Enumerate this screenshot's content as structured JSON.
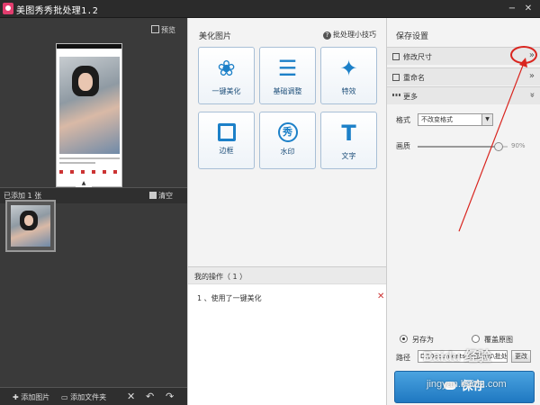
{
  "window": {
    "title": "美图秀秀批处理1.2",
    "minimize_label": "−",
    "close_label": "✕"
  },
  "left_panel": {
    "preview_label": "预览",
    "added_count": "已添加 1 张",
    "clear_label": "清空",
    "collapse_label": "▲",
    "add_image_label": "添加图片",
    "add_folder_label": "添加文件夹",
    "delete_icon": "✕",
    "undo_icon": "↶",
    "redo_icon": "↷"
  },
  "beautify": {
    "title": "美化图片",
    "tips_label": "批处理小技巧",
    "tools": [
      {
        "label": "一键美化",
        "icon": "tulip-icon",
        "glyph": "❀"
      },
      {
        "label": "基础调整",
        "icon": "sliders-icon",
        "glyph": "☰"
      },
      {
        "label": "特效",
        "icon": "magic-wand-icon",
        "glyph": "✦"
      },
      {
        "label": "边框",
        "icon": "frame-icon",
        "glyph": ""
      },
      {
        "label": "水印",
        "icon": "watermark-icon",
        "glyph": "秀"
      },
      {
        "label": "文字",
        "icon": "text-icon",
        "glyph": "T"
      }
    ]
  },
  "operations": {
    "title": "我的操作（ 1 ）",
    "items": [
      {
        "text": "1 、使用了一键美化",
        "remove": "✕"
      }
    ]
  },
  "save_settings": {
    "title": "保存设置",
    "sections": [
      {
        "label": "修改尺寸",
        "chevron": "»"
      },
      {
        "label": "重命名",
        "chevron": "»"
      },
      {
        "label": "更多",
        "chevron": "»"
      }
    ],
    "format_label": "格式",
    "format_value": "不改变格式",
    "quality_label": "画质",
    "quality_value": "90%",
    "quality_percent": 90,
    "save_as_label": "另存为",
    "overwrite_label": "覆盖原图",
    "path_label": "路径",
    "path_value": "D:\\Documents\\美图图库\\批处",
    "change_label": "更改",
    "save_label": "保存"
  },
  "watermark": {
    "line1": "Baidu 经验",
    "line2": "jingyan.baidu.com"
  },
  "colors": {
    "accent": "#1c80c8",
    "annotation": "#d9251f"
  }
}
